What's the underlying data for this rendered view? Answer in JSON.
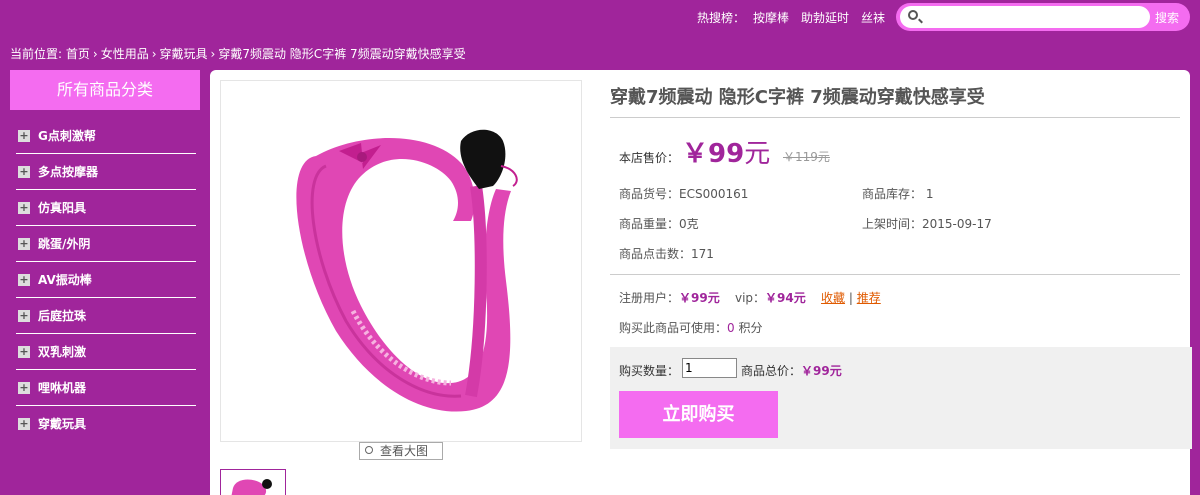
{
  "header": {
    "hot_title": "热搜榜：",
    "hot_links": [
      "按摩棒",
      "助勃延时",
      "丝袜"
    ],
    "search_placeholder": "",
    "search_button": "搜索"
  },
  "breadcrumb": {
    "prefix": "当前位置:",
    "items": [
      "首页",
      "女性用品",
      "穿戴玩具",
      "穿戴7频震动 隐形C字裤 7频震动穿戴快感享受"
    ]
  },
  "sidebar": {
    "title": "所有商品分类",
    "items": [
      "G点刺激帮",
      "多点按摩器",
      "仿真阳具",
      "跳蛋/外阴",
      "AV振动棒",
      "后庭拉珠",
      "双乳刺激",
      "哩咻机器",
      "穿戴玩具"
    ]
  },
  "product": {
    "title": "穿戴7频震动 隐形C字裤 7频震动穿戴快感享受",
    "price_label": "本店售价：",
    "price": "￥99",
    "price_unit": "元",
    "old_price": "￥119元",
    "sku_label": "商品货号：",
    "sku": "ECS000161",
    "stock_label": "商品库存：",
    "stock": "1",
    "weight_label": "商品重量：",
    "weight": "0克",
    "date_label": "上架时间：",
    "date": "2015-09-17",
    "clicks_label": "商品点击数：",
    "clicks": "171",
    "member_label": "注册用户：",
    "member_price": "￥99元",
    "vip_label": "vip：",
    "vip_price": "￥94元",
    "favorite": "收藏",
    "recommend": "推荐",
    "sep": "|",
    "points_prefix": "购买此商品可使用：",
    "points": "0",
    "points_suffix": "积分",
    "qty_label": "购买数量：",
    "qty": "1",
    "total_label": "商品总价：",
    "total": "￥99元",
    "buy_button": "立即购买",
    "view_large": "查看大图"
  },
  "colors": {
    "background": "#a0259b",
    "accent": "#f46cf0",
    "price": "#a0259b",
    "link": "#e05a00"
  },
  "icons": {
    "search": "search-icon",
    "category_expand": "plus-icon",
    "view_large": "map-pin-icon"
  }
}
